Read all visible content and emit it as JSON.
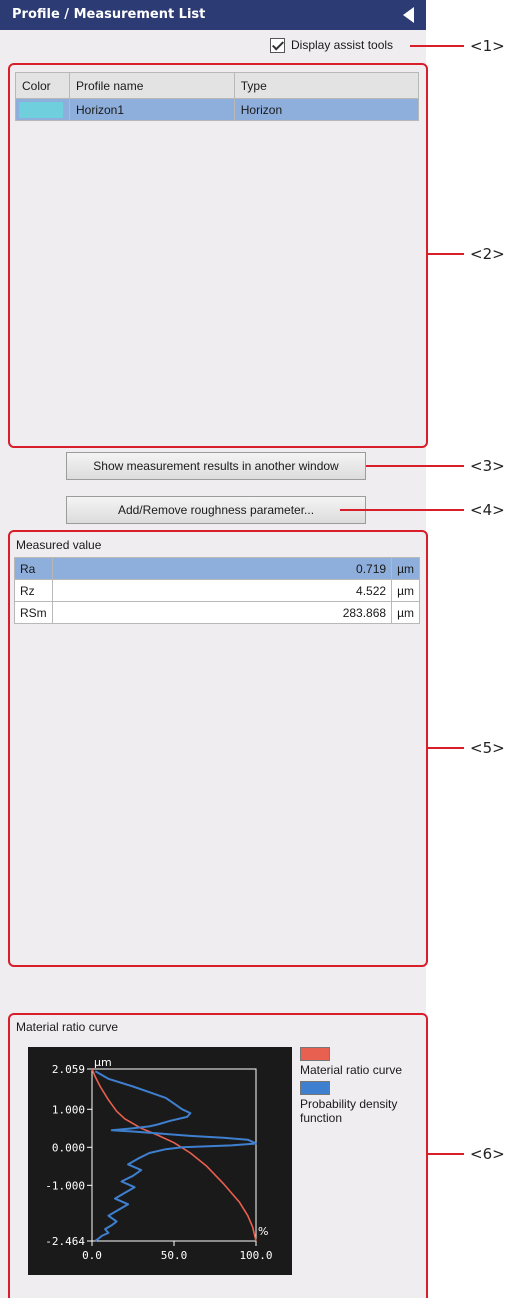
{
  "panel": {
    "title": "Profile / Measurement List",
    "display_assist_tools": "Display assist tools"
  },
  "profiles": {
    "headers": [
      "Color",
      "Profile name",
      "Type"
    ],
    "rows": [
      {
        "color": "#6fcfdc",
        "name": "Horizon1",
        "type": "Horizon"
      }
    ]
  },
  "buttons": {
    "show_results": "Show measurement results in another window",
    "add_remove": "Add/Remove roughness parameter..."
  },
  "measured": {
    "title": "Measured value",
    "rows": [
      {
        "param": "Ra",
        "value": "0.719",
        "unit": "µm"
      },
      {
        "param": "Rz",
        "value": "4.522",
        "unit": "µm"
      },
      {
        "param": "RSm",
        "value": "283.868",
        "unit": "µm"
      }
    ]
  },
  "material_ratio": {
    "title": "Material ratio curve",
    "legend": [
      {
        "label": "Material ratio curve",
        "color": "#e8604f"
      },
      {
        "label": "Probability density function",
        "color": "#3f7fcf"
      }
    ]
  },
  "chart_data": {
    "type": "line",
    "title": "Material ratio curve",
    "ylabel": "µm",
    "xlabel": "%",
    "xlim": [
      0,
      100
    ],
    "ylim": [
      -2.464,
      2.059
    ],
    "x_ticks": [
      "0.0",
      "50.0",
      "100.0"
    ],
    "y_ticks": [
      "2.059",
      "1.000",
      "0.000",
      "-1.000",
      "-2.464"
    ],
    "series": [
      {
        "name": "Material ratio curve",
        "color": "#e8604f",
        "x": [
          0,
          2,
          5,
          10,
          15,
          20,
          30,
          40,
          50,
          60,
          70,
          80,
          90,
          95,
          98,
          100
        ],
        "y": [
          2.059,
          1.85,
          1.6,
          1.25,
          0.95,
          0.75,
          0.5,
          0.32,
          0.12,
          -0.15,
          -0.5,
          -0.95,
          -1.45,
          -1.8,
          -2.1,
          -2.464
        ]
      },
      {
        "name": "Probability density function",
        "color": "#3f7fcf",
        "x": [
          2,
          10,
          25,
          35,
          45,
          50,
          55,
          60,
          58,
          48,
          40,
          35,
          25,
          12,
          30,
          45,
          60,
          80,
          95,
          100,
          85,
          55,
          45,
          35,
          28,
          22,
          30,
          25,
          18,
          26,
          20,
          14,
          22,
          16,
          10,
          15,
          12,
          8,
          10,
          6,
          4,
          2
        ],
        "y": [
          2.0,
          1.8,
          1.6,
          1.45,
          1.3,
          1.15,
          1.0,
          0.9,
          0.8,
          0.7,
          0.6,
          0.55,
          0.5,
          0.45,
          0.4,
          0.35,
          0.3,
          0.25,
          0.2,
          0.1,
          0.05,
          0.0,
          -0.05,
          -0.15,
          -0.3,
          -0.45,
          -0.6,
          -0.75,
          -0.9,
          -1.05,
          -1.2,
          -1.35,
          -1.5,
          -1.65,
          -1.8,
          -1.95,
          -2.05,
          -2.15,
          -2.25,
          -2.33,
          -2.4,
          -2.46
        ]
      }
    ]
  },
  "callouts": [
    "<1>",
    "<2>",
    "<3>",
    "<4>",
    "<5>",
    "<6>"
  ]
}
